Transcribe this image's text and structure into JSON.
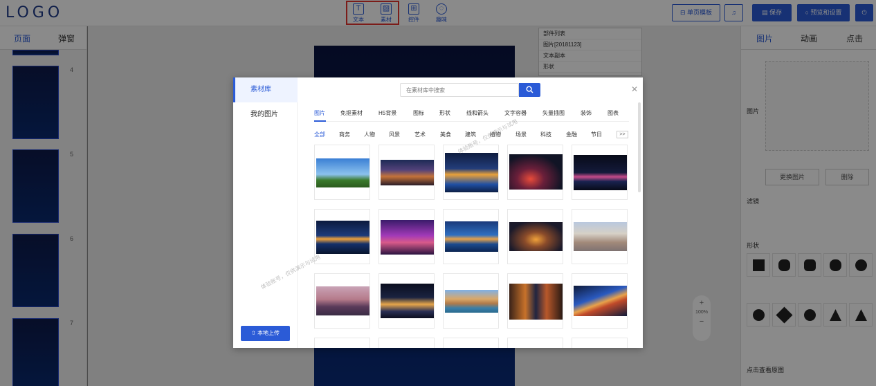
{
  "app": {
    "logo": "LOGO"
  },
  "toolbar": {
    "tools": [
      {
        "label": "文本",
        "icon": "text-icon"
      },
      {
        "label": "素材",
        "icon": "image-icon"
      },
      {
        "label": "控件",
        "icon": "widget-icon"
      },
      {
        "label": "趣味",
        "icon": "bulb-icon"
      }
    ],
    "single_page_template": "单页模板",
    "save": "保存",
    "preview_settings": "预览和设置"
  },
  "left_panel": {
    "tabs": [
      "页面",
      "弹窗"
    ],
    "pages": [
      "4",
      "5",
      "6",
      "7"
    ]
  },
  "layers_panel": {
    "title": "部件列表",
    "items": [
      "图片[20181123]",
      "文本副本",
      "形状"
    ]
  },
  "zoom": {
    "plus": "+",
    "level": "100%",
    "minus": "−"
  },
  "right_panel": {
    "tabs": [
      "图片",
      "动画",
      "点击"
    ],
    "image_label": "图片",
    "replace_button": "更换图片",
    "delete_button": "删除",
    "filter_label": "滤镜",
    "shape_label": "形状",
    "click_view_label": "点击查看原图"
  },
  "modal": {
    "sidebar": {
      "library": "素材库",
      "my_images": "我的图片",
      "upload": "本地上传"
    },
    "search_placeholder": "在素材库中搜索",
    "categories": [
      "图片",
      "免抠素材",
      "H5背景",
      "图标",
      "形状",
      "线和箭头",
      "文字容器",
      "矢量插图",
      "装饰",
      "图表"
    ],
    "subcategories": [
      "全部",
      "商务",
      "人物",
      "风景",
      "艺术",
      "美食",
      "建筑",
      "植物",
      "场景",
      "科技",
      "金融",
      "节日"
    ],
    "more": ">>",
    "watermarks": [
      "体验账号，仅供演示与试用",
      "体验账号，仅供演示与试用"
    ],
    "thumbnail_icons": [
      "eiffel-tower-photo-icon",
      "city-night-panorama-photo-icon",
      "waterfront-night-lights-photo-icon",
      "city-night-aerial-photo-icon",
      "skyline-night-photo-icon",
      "skyline-reflection-photo-icon",
      "purple-tower-skyline-photo-icon",
      "river-city-dusk-photo-icon",
      "city-lights-aerial-photo-icon",
      "palace-building-photo-icon",
      "shanghai-skyline-photo-icon",
      "harbor-night-photo-icon",
      "venice-canal-photo-icon",
      "narrow-canal-night-photo-icon",
      "light-trails-tunnel-photo-icon"
    ]
  }
}
